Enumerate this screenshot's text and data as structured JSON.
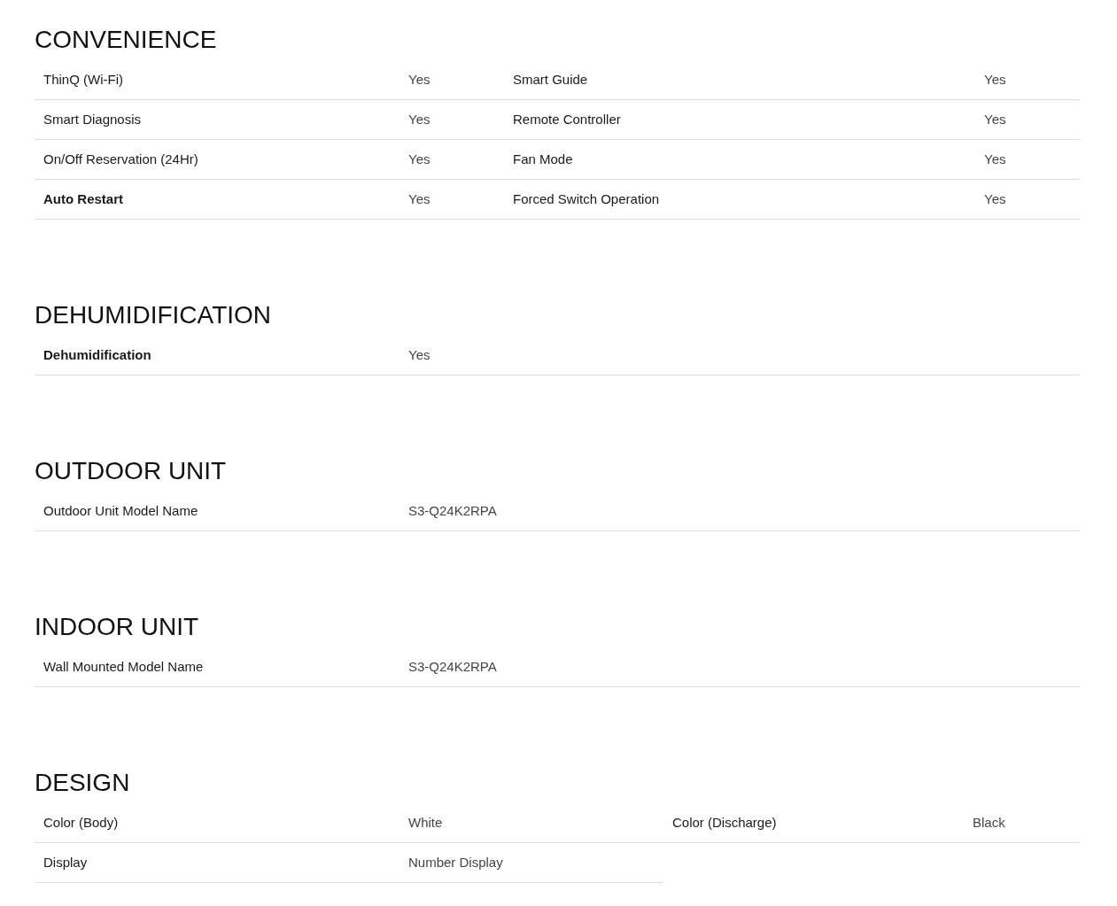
{
  "sections": [
    {
      "title": "CONVENIENCE",
      "kind": "paired",
      "rows": [
        [
          {
            "label": "ThinQ (Wi-Fi)",
            "value": "Yes",
            "strong": false
          },
          {
            "label": "Smart Guide",
            "value": "Yes",
            "strong": false
          }
        ],
        [
          {
            "label": "Smart Diagnosis",
            "value": "Yes",
            "strong": false
          },
          {
            "label": "Remote Controller",
            "value": "Yes",
            "strong": false
          }
        ],
        [
          {
            "label": "On/Off Reservation (24Hr)",
            "value": "Yes",
            "strong": false
          },
          {
            "label": "Fan Mode",
            "value": "Yes",
            "strong": false
          }
        ],
        [
          {
            "label": "Auto Restart",
            "value": "Yes",
            "strong": true
          },
          {
            "label": "Forced Switch Operation",
            "value": "Yes",
            "strong": false
          }
        ]
      ]
    },
    {
      "title": "DEHUMIDIFICATION",
      "kind": "single",
      "rows": [
        [
          {
            "label": "Dehumidification",
            "value": "Yes",
            "strong": true
          }
        ]
      ]
    },
    {
      "title": "OUTDOOR UNIT",
      "kind": "single",
      "rows": [
        [
          {
            "label": "Outdoor Unit Model Name",
            "value": "S3-Q24K2RPA",
            "strong": false
          }
        ]
      ]
    },
    {
      "title": "INDOOR UNIT",
      "kind": "single",
      "rows": [
        [
          {
            "label": "Wall Mounted Model Name",
            "value": "S3-Q24K2RPA",
            "strong": false
          }
        ]
      ]
    },
    {
      "title": "DESIGN",
      "kind": "split",
      "rows": [
        [
          {
            "label": "Color (Body)",
            "value": "White",
            "strong": false
          },
          {
            "label": "Color (Discharge)",
            "value": "Black",
            "strong": false
          }
        ],
        [
          {
            "label": "Display",
            "value": "Number Display",
            "strong": false
          }
        ]
      ]
    }
  ]
}
